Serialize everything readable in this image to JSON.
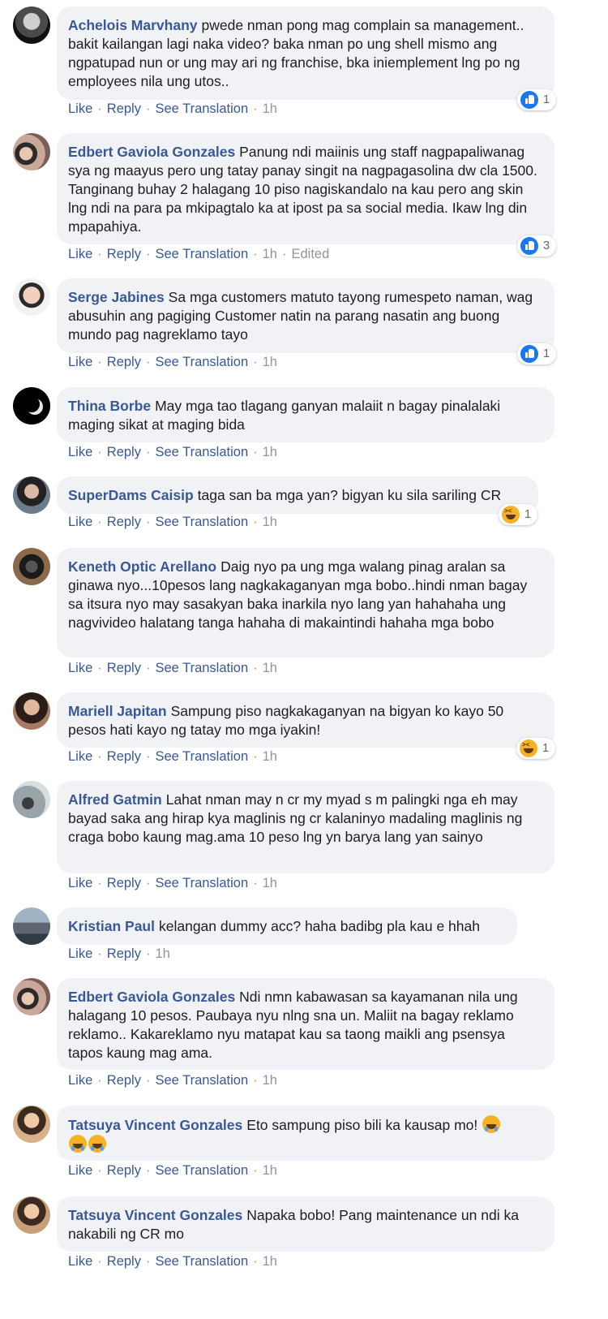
{
  "actions": {
    "like": "Like",
    "reply": "Reply",
    "see_translation": "See Translation",
    "separator": "·",
    "edited": "Edited"
  },
  "comments": [
    {
      "author": "Achelois Marvhany",
      "text": "pwede nman pong mag complain sa management.. bakit kailangan lagi naka video? baka nman po ung shell mismo ang ngpatupad nun or ung may ari ng franchise, bka iniemplement lng po ng employees nila ung utos..",
      "time": "1h",
      "reaction": {
        "type": "like",
        "count": "1"
      }
    },
    {
      "author": "Edbert Gaviola Gonzales",
      "text": "Panung ndi maiinis ung staff nagpapaliwanag sya ng maayus pero ung tatay panay singit na nagpagasolina dw cla 1500. Tanginang buhay 2 halagang 10 piso nagiskandalo na kau pero ang skin lng ndi na para pa mkipagtalo ka at ipost pa sa social media. Ikaw lng din mpapahiya.",
      "time": "1h",
      "reaction": {
        "type": "like",
        "count": "3"
      }
    },
    {
      "author": "Serge Jabines",
      "text": "Sa mga customers matuto tayong rumespeto naman, wag abusuhin ang pagiging Customer natin na parang nasatin ang buong mundo pag nagreklamo tayo",
      "time": "1h",
      "reaction": {
        "type": "like",
        "count": "1"
      }
    },
    {
      "author": "Thina Borbe",
      "text": "May mga tao tlagang ganyan malaiit n bagay pinalalaki maging sikat at maging bida",
      "time": "1h"
    },
    {
      "author": "SuperDams Caisip",
      "text": "taga san ba mga yan? bigyan ku sila sariling CR",
      "time": "1h",
      "reaction": {
        "type": "haha",
        "count": "1"
      }
    },
    {
      "author": "Keneth Optic Arellano",
      "text": "Daig nyo pa ung mga walang pinag aralan sa ginawa nyo...10pesos lang nagkakaganyan mga bobo..hindi nman bagay sa itsura nyo may sasakyan baka inarkila nyo lang yan hahahaha ung nagvivideo halatang tanga hahaha di makaintindi hahaha mga bobo",
      "time": "1h"
    },
    {
      "author": "Mariell Japitan",
      "text": "Sampung piso nagkakaganyan na bigyan ko kayo 50 pesos hati kayo ng tatay mo mga iyakin!",
      "time": "1h",
      "reaction": {
        "type": "haha",
        "count": "1"
      }
    },
    {
      "author": "Alfred Gatmin",
      "text": "Lahat nman may n cr my myad s m palingki nga eh may bayad saka ang hirap kya maglinis ng cr kalaninyo madaling maglinis ng craga bobo kaung mag.ama 10 peso lng yn barya lang yan sainyo",
      "time": "1h"
    },
    {
      "author": "Kristian Paul",
      "text": "kelangan dummy acc? haha badibg pla kau e hhah",
      "time": "1h"
    },
    {
      "author": "Edbert Gaviola Gonzales",
      "text": "Ndi nmn kabawasan sa kayamanan nila ung halagang 10 pesos. Paubaya nyu nlng sna un. Maliit na bagay reklamo reklamo.. Kakareklamo nyu matapat kau sa taong maikli ang psensya tapos kaung mag ama.",
      "time": "1h"
    },
    {
      "author": "Tatsuya Vincent Gonzales",
      "text": "Eto sampung piso bili ka kausap mo!",
      "time": "1h"
    },
    {
      "author": "Tatsuya Vincent Gonzales",
      "text": "Napaka bobo! Pang maintenance un ndi ka nakabili ng CR mo",
      "time": "1h"
    }
  ]
}
